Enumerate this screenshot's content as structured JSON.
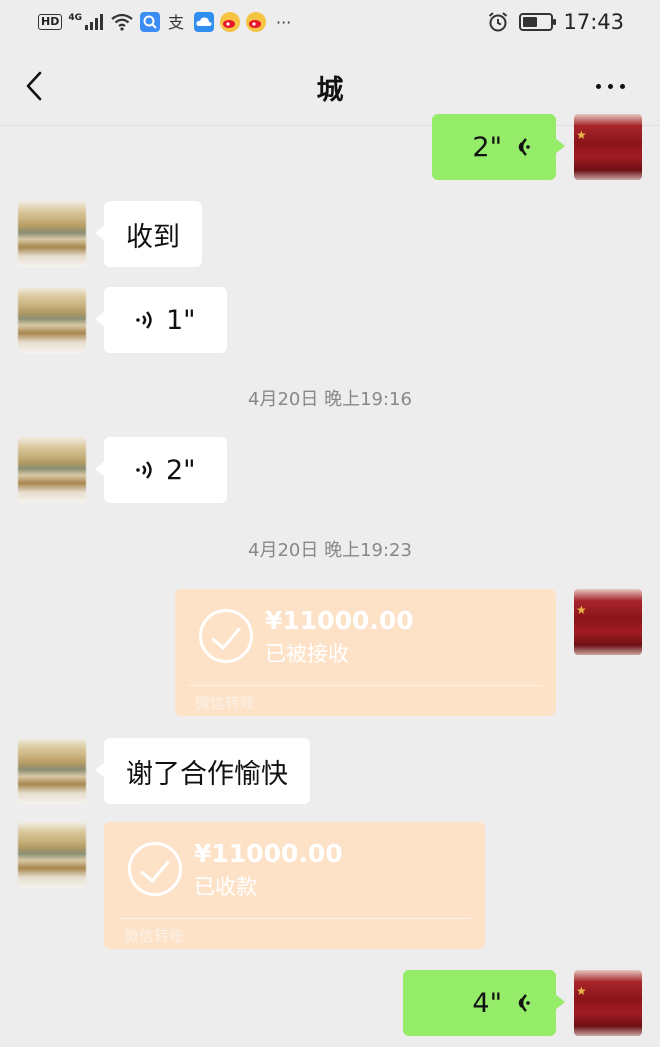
{
  "status_bar": {
    "left_badge": "HD",
    "network": "4G",
    "time": "17:43",
    "icons": [
      "signal-icon",
      "wifi-icon",
      "search-app-icon",
      "alipay-icon",
      "cloud-app-icon",
      "weibo-icon",
      "weibo-icon",
      "more-notifications-icon",
      "alarm-icon",
      "battery-icon"
    ],
    "more_notifications": "···"
  },
  "nav": {
    "title": "城",
    "back_icon": "chevron-left-icon",
    "more_icon": "more-icon"
  },
  "colors": {
    "background": "#ededed",
    "green_bubble": "#95ec69",
    "white_bubble": "#ffffff",
    "transfer_card": "#fde2c8",
    "timestamp_text": "#888888"
  },
  "messages": [
    {
      "side": "right",
      "kind": "voice",
      "duration": "2\""
    },
    {
      "side": "left",
      "kind": "text",
      "text": "收到"
    },
    {
      "side": "left",
      "kind": "voice",
      "duration": "1\""
    },
    {
      "kind": "timestamp",
      "text": "4月20日 晚上19:16"
    },
    {
      "side": "left",
      "kind": "voice",
      "duration": "2\""
    },
    {
      "kind": "timestamp",
      "text": "4月20日 晚上19:23"
    },
    {
      "side": "right",
      "kind": "transfer",
      "amount": "¥11000.00",
      "status": "已被接收",
      "brand": "微信转账"
    },
    {
      "side": "left",
      "kind": "text",
      "text": "谢了合作愉快"
    },
    {
      "side": "left",
      "kind": "transfer",
      "amount": "¥11000.00",
      "status": "已收款",
      "brand": "微信转账"
    },
    {
      "side": "right",
      "kind": "voice",
      "duration": "4\""
    }
  ]
}
